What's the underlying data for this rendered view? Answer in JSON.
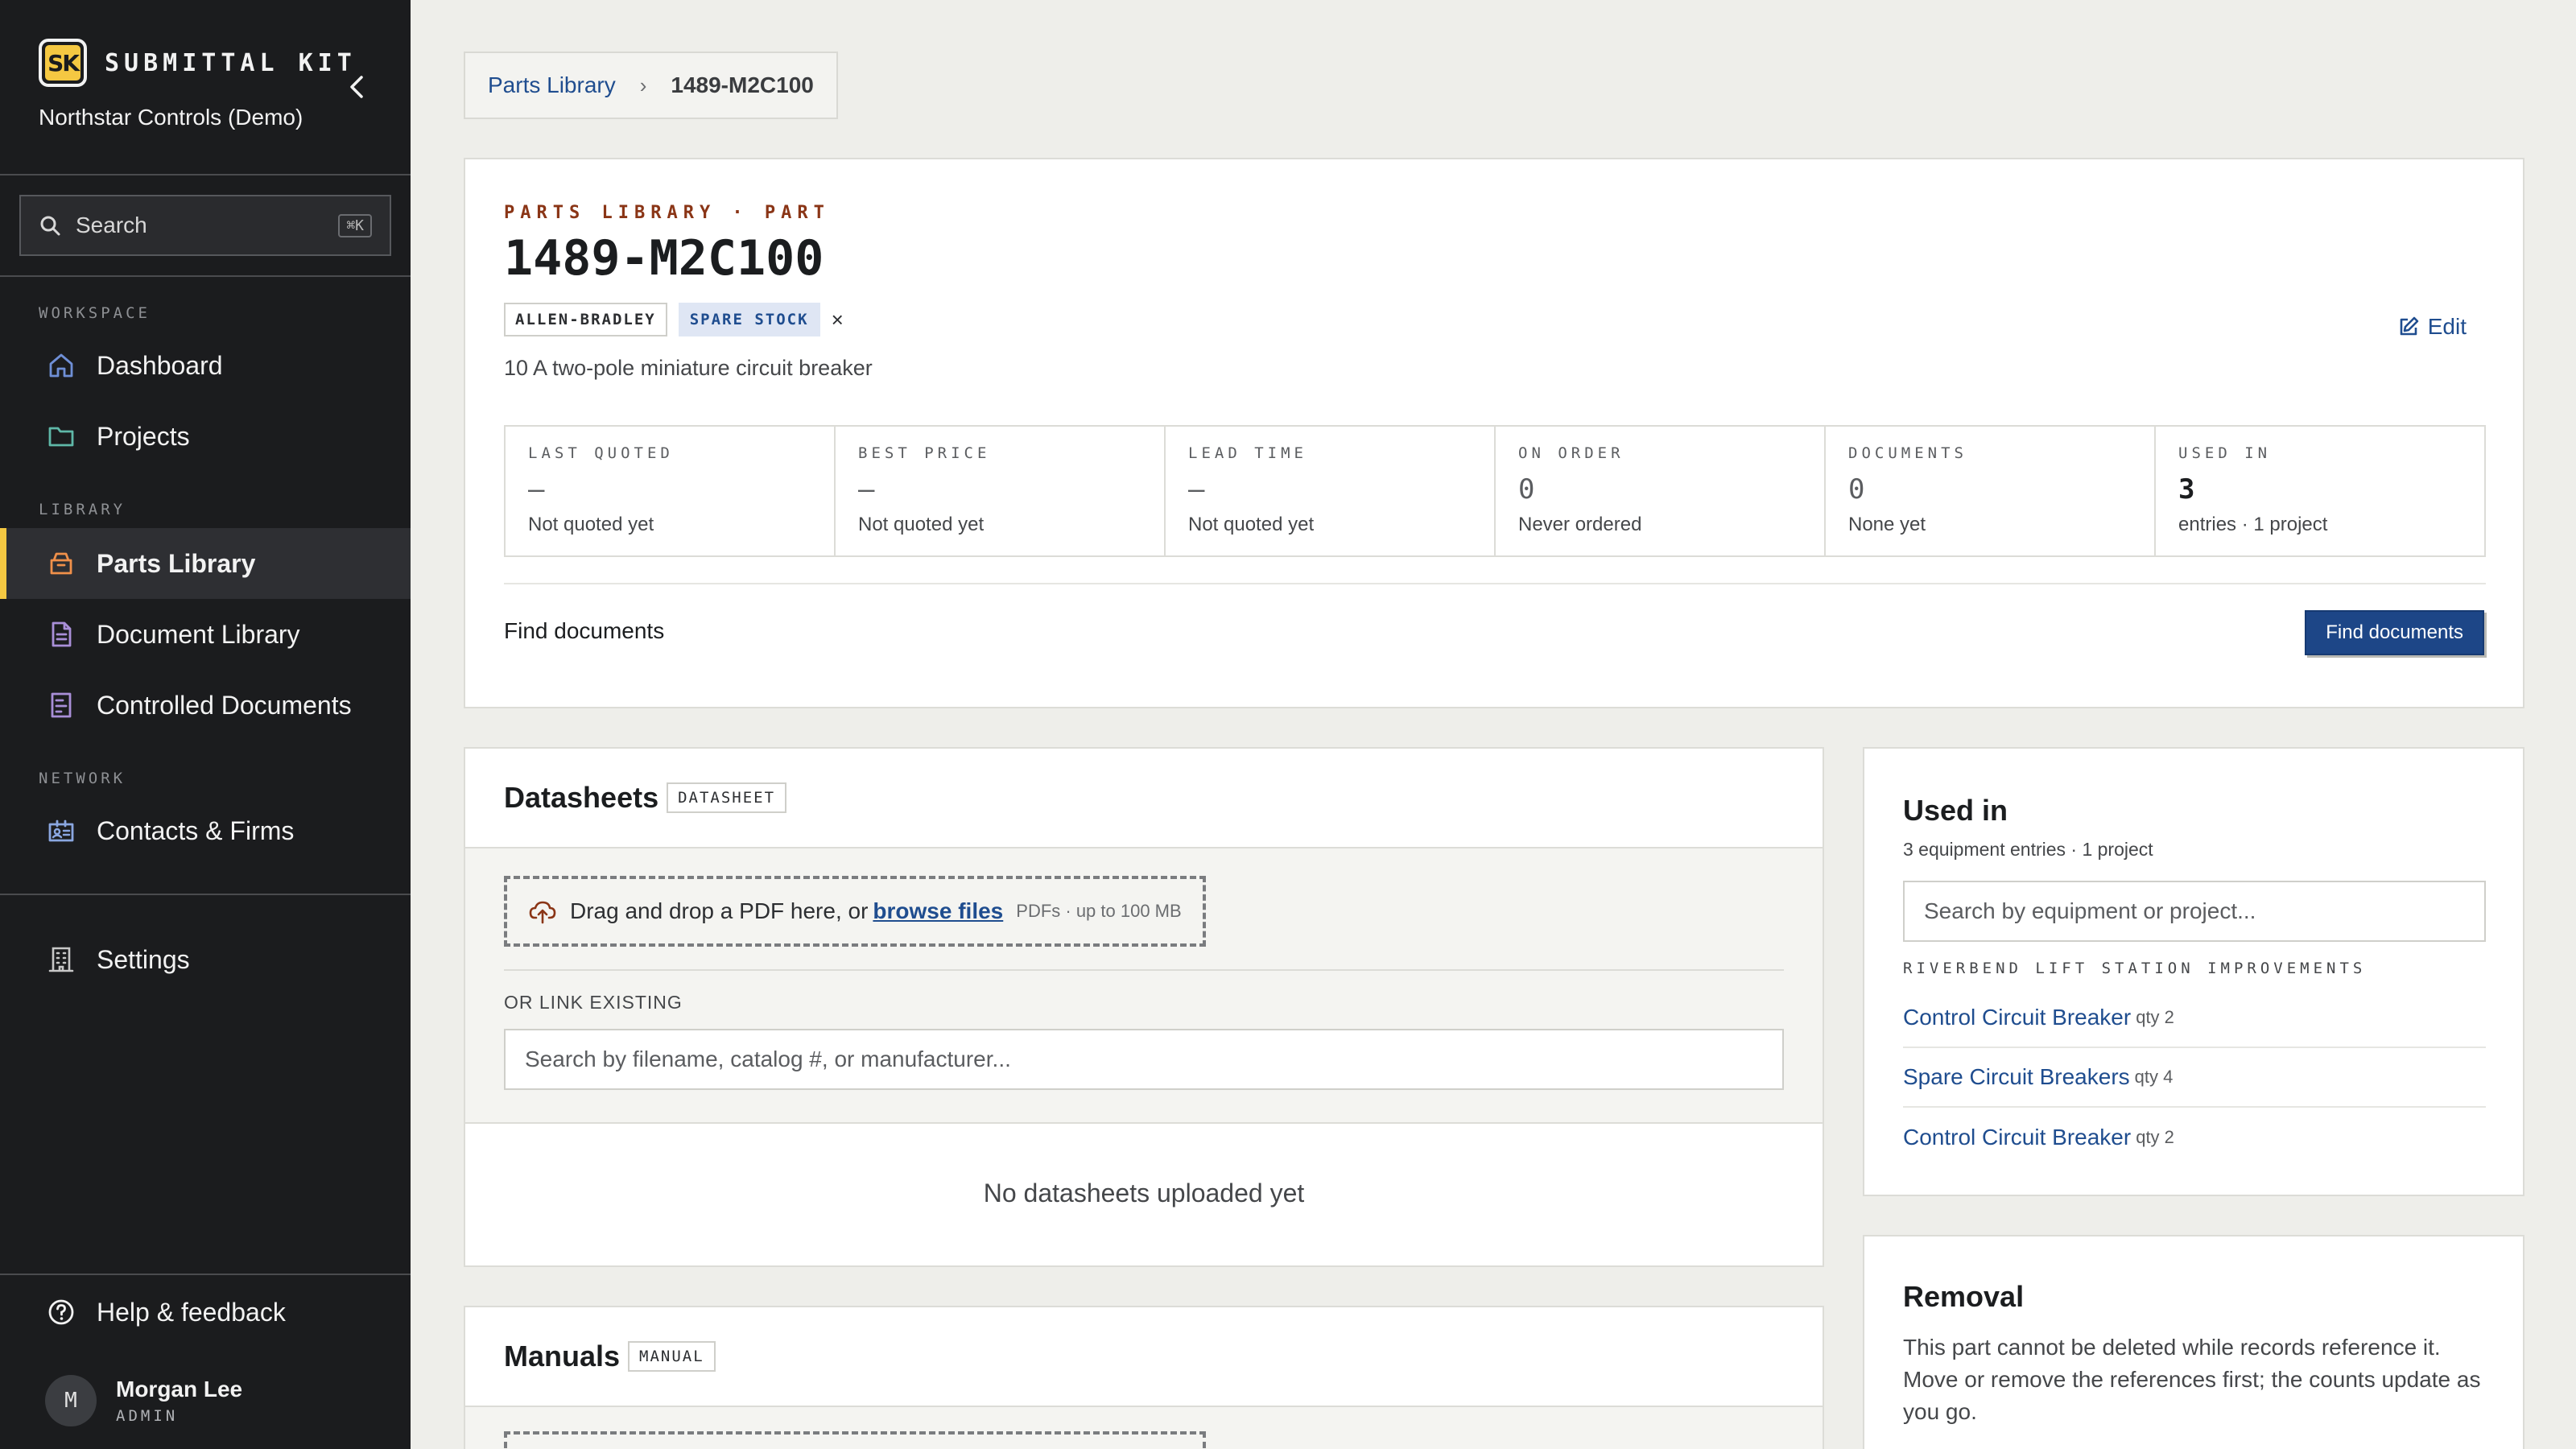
{
  "app": {
    "logo_text": "SK",
    "name": "SUBMITTAL KIT",
    "org": "Northstar Controls (Demo)"
  },
  "search": {
    "label": "Search",
    "shortcut": "⌘K"
  },
  "nav": {
    "sections": {
      "workspace": "WORKSPACE",
      "library": "LIBRARY",
      "network": "NETWORK"
    },
    "items": [
      {
        "label": "Dashboard",
        "icon": "home-icon"
      },
      {
        "label": "Projects",
        "icon": "folder-icon"
      },
      {
        "label": "Parts Library",
        "icon": "box-icon",
        "active": true
      },
      {
        "label": "Document Library",
        "icon": "document-icon"
      },
      {
        "label": "Controlled Documents",
        "icon": "controlled-document-icon"
      },
      {
        "label": "Contacts & Firms",
        "icon": "contact-card-icon"
      },
      {
        "label": "Settings",
        "icon": "building-icon"
      }
    ],
    "help": "Help & feedback"
  },
  "user": {
    "initial": "M",
    "name": "Morgan Lee",
    "role": "ADMIN"
  },
  "breadcrumb": {
    "parent": "Parts Library",
    "current": "1489-M2C100"
  },
  "part": {
    "eyebrow": "PARTS LIBRARY · PART",
    "number": "1489-M2C100",
    "manufacturer_tag": "ALLEN-BRADLEY",
    "status_tag": "SPARE STOCK",
    "remove_tag": "×",
    "description": "10 A two-pole miniature circuit breaker",
    "edit_label": "Edit"
  },
  "stats": [
    {
      "label": "LAST QUOTED",
      "value": "—",
      "sub": "Not quoted yet"
    },
    {
      "label": "BEST PRICE",
      "value": "—",
      "sub": "Not quoted yet"
    },
    {
      "label": "LEAD TIME",
      "value": "—",
      "sub": "Not quoted yet"
    },
    {
      "label": "ON ORDER",
      "value": "0",
      "sub": "Never ordered"
    },
    {
      "label": "DOCUMENTS",
      "value": "0",
      "sub": "None yet"
    },
    {
      "label": "USED IN",
      "value": "3",
      "sub": "entries · 1 project"
    }
  ],
  "find": {
    "label": "Find documents",
    "button": "Find documents"
  },
  "datasheets": {
    "title": "Datasheets",
    "tag": "DATASHEET",
    "drop_text": "Drag and drop a PDF here, or",
    "browse": "browse files",
    "hint": "PDFs · up to 100 MB",
    "or_link": "OR LINK EXISTING",
    "search_placeholder": "Search by filename, catalog #, or manufacturer...",
    "empty": "No datasheets uploaded yet"
  },
  "manuals": {
    "title": "Manuals",
    "tag": "MANUAL"
  },
  "used_in": {
    "title": "Used in",
    "subtitle": "3 equipment entries · 1 project",
    "search_placeholder": "Search by equipment or project...",
    "project": "RIVERBEND LIFT STATION IMPROVEMENTS",
    "entries": [
      {
        "name": "Control Circuit Breaker",
        "qty": "qty 2"
      },
      {
        "name": "Spare Circuit Breakers",
        "qty": "qty 4"
      },
      {
        "name": "Control Circuit Breaker",
        "qty": "qty 2"
      }
    ]
  },
  "removal": {
    "title": "Removal",
    "text": "This part cannot be deleted while records reference it. Move or remove the references first; the counts update as you go."
  },
  "colors": {
    "sidebar_bg": "#1b1c1e",
    "accent_yellow": "#f5c842",
    "link_blue": "#1f4d8f",
    "eyebrow_rust": "#8a3516",
    "primary_button": "#1d4687"
  }
}
